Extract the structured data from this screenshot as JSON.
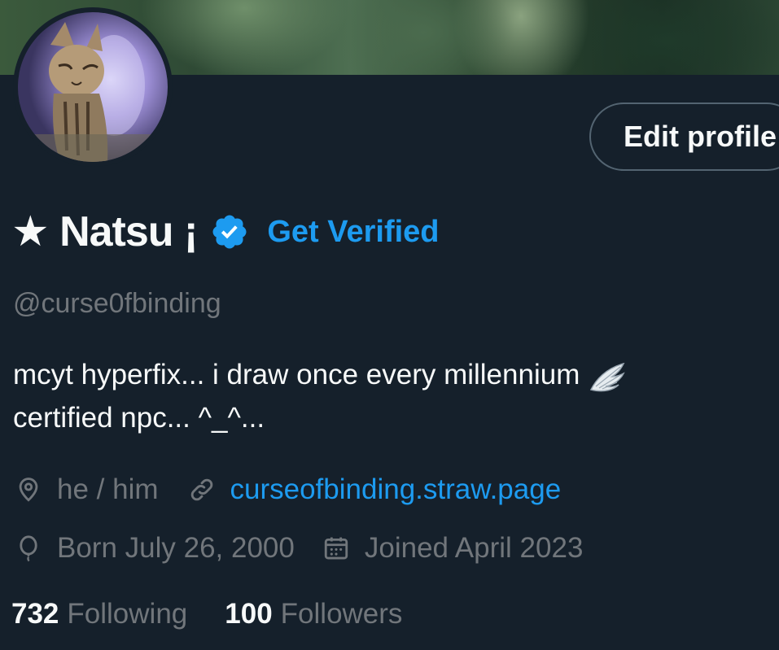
{
  "profile": {
    "display_name": "★ Natsu ¡",
    "get_verified_label": "Get Verified",
    "handle": "@curse0fbinding",
    "edit_profile_label": "Edit profile",
    "bio_lines": [
      "mcyt hyperfix... i draw once every millennium",
      "certified npc... ^_^..."
    ],
    "pronouns": "he / him",
    "website": "curseofbinding.straw.page",
    "birthday": "Born July 26, 2000",
    "joined": "Joined April 2023",
    "following_count": "732",
    "following_label": "Following",
    "followers_count": "100",
    "followers_label": "Followers"
  },
  "icons": {
    "verified": "verified-badge-icon",
    "location": "location-pin-icon",
    "link": "link-icon",
    "birthday": "balloon-icon",
    "joined": "calendar-icon",
    "bio_emoji": "wing-emoji"
  },
  "colors": {
    "background": "#15202b",
    "text_primary": "#f7f9f9",
    "text_secondary": "#71767b",
    "accent": "#1d9bf0",
    "button_border": "#536471"
  }
}
